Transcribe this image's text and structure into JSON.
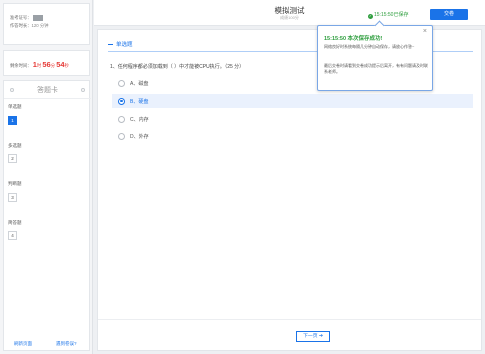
{
  "candidate": {
    "id_label": "准考证号：",
    "duration_label": "作答时长：",
    "duration_value": "120 分钟"
  },
  "timer": {
    "label": "剩余时间：",
    "hours": "1",
    "hours_unit": "时",
    "minutes": "56",
    "minutes_unit": "分",
    "seconds": "54",
    "seconds_unit": "秒"
  },
  "answer_sheet": {
    "title": "答题卡",
    "sections": [
      {
        "label": "单选题",
        "number": "1",
        "active": true
      },
      {
        "label": "多选题",
        "number": "2",
        "active": false
      },
      {
        "label": "判断题",
        "number": "3",
        "active": false
      },
      {
        "label": "简答题",
        "number": "4",
        "active": false
      }
    ],
    "refresh_link": "刷新页面",
    "feedback_link": "遇到卷误?"
  },
  "header": {
    "title": "模拟测试",
    "subtitle": "成绩100分",
    "saved_status": "15:15:50已保存",
    "submit_label": "交卷"
  },
  "question": {
    "section_title": "单选题",
    "text": "1、任何程序都必须加载到（ ）中才能被CPU执行。（25 分）",
    "options": [
      {
        "label": "A、磁盘",
        "selected": false
      },
      {
        "label": "B、硬盘",
        "selected": true
      },
      {
        "label": "C、内存",
        "selected": false
      },
      {
        "label": "D、外存",
        "selected": false
      }
    ],
    "next_label": "下一页 ➔"
  },
  "toast": {
    "title": "15:15:50 本次保存成功!",
    "body1": "网络良好时系统每隔几分钟自动保存，请放心作答~",
    "body2": "最后交卷时请看到交卷成功提示后离开，有有问题请及时联系老师。"
  },
  "colors": {
    "accent": "#1a73e8",
    "success": "#2e9e3e",
    "timer": "#e53935"
  }
}
